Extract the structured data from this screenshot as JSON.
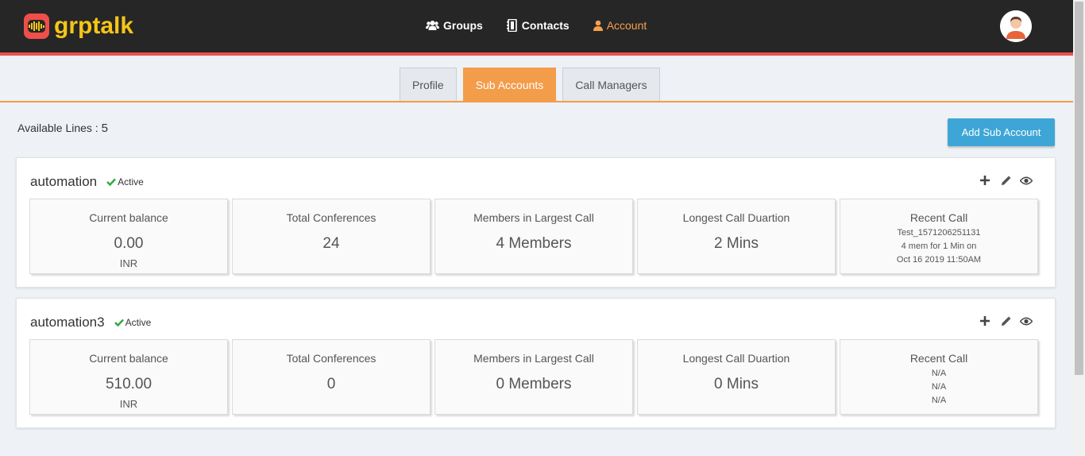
{
  "app": {
    "logo_text": "grptalk"
  },
  "nav": {
    "groups": "Groups",
    "contacts": "Contacts",
    "account": "Account"
  },
  "tabs": [
    {
      "label": "Profile"
    },
    {
      "label": "Sub Accounts"
    },
    {
      "label": "Call Managers"
    }
  ],
  "available_lines": {
    "label": "Available Lines :",
    "value": "5"
  },
  "add_button": "Add Sub Account",
  "colors": {
    "accent": "#f39c4a",
    "header": "#262626",
    "brand_red": "#ef4f4a",
    "brand_yellow": "#f5c518",
    "button_blue": "#3ea6d6",
    "active_green": "#2eaa3a"
  },
  "accounts": [
    {
      "name": "automation",
      "status": "Active",
      "stats": {
        "balance_label": "Current balance",
        "balance": "0.00",
        "currency": "INR",
        "conferences_label": "Total Conferences",
        "conferences": "24",
        "members_label": "Members in Largest Call",
        "members": "4 Members",
        "longest_label": "Longest Call Duartion",
        "longest": "2 Mins",
        "recent_label": "Recent Call",
        "recent_1": "Test_1571206251131",
        "recent_2": "4 mem for 1 Min on",
        "recent_3": "Oct 16 2019 11:50AM"
      }
    },
    {
      "name": "automation3",
      "status": "Active",
      "stats": {
        "balance_label": "Current balance",
        "balance": "510.00",
        "currency": "INR",
        "conferences_label": "Total Conferences",
        "conferences": "0",
        "members_label": "Members in Largest Call",
        "members": "0 Members",
        "longest_label": "Longest Call Duartion",
        "longest": "0 Mins",
        "recent_label": "Recent Call",
        "recent_1": "N/A",
        "recent_2": "N/A",
        "recent_3": "N/A"
      }
    }
  ],
  "icons": [
    "users-icon",
    "address-book-icon",
    "user-icon",
    "plus-icon",
    "pencil-icon",
    "eye-icon",
    "check-icon",
    "avatar"
  ]
}
